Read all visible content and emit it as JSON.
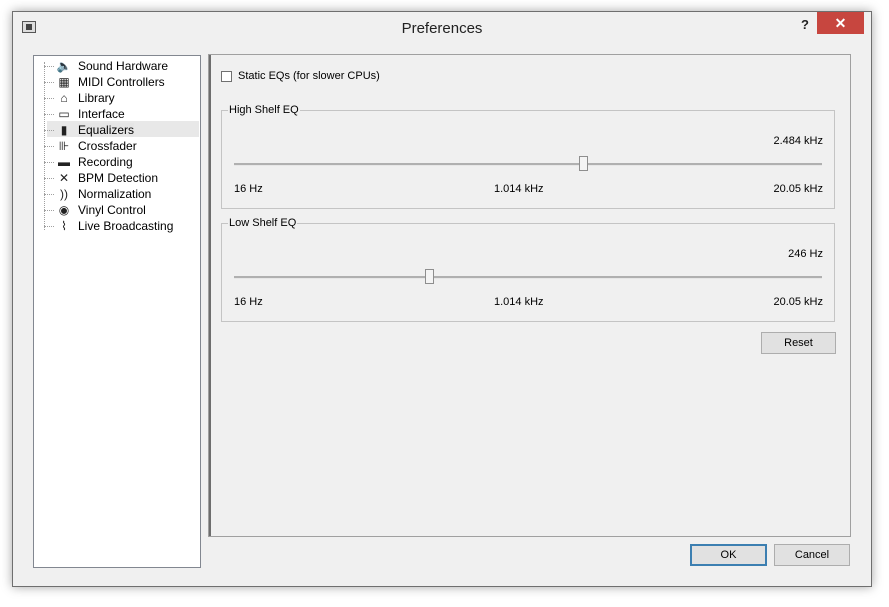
{
  "window": {
    "title": "Preferences",
    "help": "?",
    "close": "✕"
  },
  "tree": {
    "items": [
      {
        "label": "Sound Hardware",
        "icon": "speaker-icon",
        "glyph": "🔈"
      },
      {
        "label": "MIDI Controllers",
        "icon": "midi-keyboard-icon",
        "glyph": "▦"
      },
      {
        "label": "Library",
        "icon": "library-icon",
        "glyph": "⌂"
      },
      {
        "label": "Interface",
        "icon": "monitor-icon",
        "glyph": "▭"
      },
      {
        "label": "Equalizers",
        "icon": "equalizer-icon",
        "glyph": "▮"
      },
      {
        "label": "Crossfader",
        "icon": "crossfader-icon",
        "glyph": "⊪"
      },
      {
        "label": "Recording",
        "icon": "recording-icon",
        "glyph": "▬"
      },
      {
        "label": "BPM Detection",
        "icon": "bpm-icon",
        "glyph": "✕"
      },
      {
        "label": "Normalization",
        "icon": "normalization-icon",
        "glyph": "))"
      },
      {
        "label": "Vinyl Control",
        "icon": "vinyl-icon",
        "glyph": "◉"
      },
      {
        "label": "Live Broadcasting",
        "icon": "broadcast-icon",
        "glyph": "⌇"
      }
    ],
    "selected": 4
  },
  "equalizers": {
    "static_eq_label": "Static EQs (for slower CPUs)",
    "static_eq_checked": false,
    "high_shelf": {
      "title": "High Shelf EQ",
      "value": "2.484 kHz",
      "position": 0.595,
      "min_label": "16 Hz",
      "mid_label": "1.014 kHz",
      "max_label": "20.05 kHz"
    },
    "low_shelf": {
      "title": "Low Shelf EQ",
      "value": "246 Hz",
      "position": 0.332,
      "min_label": "16 Hz",
      "mid_label": "1.014 kHz",
      "max_label": "20.05 kHz"
    },
    "reset_label": "Reset"
  },
  "buttons": {
    "ok": "OK",
    "cancel": "Cancel"
  }
}
